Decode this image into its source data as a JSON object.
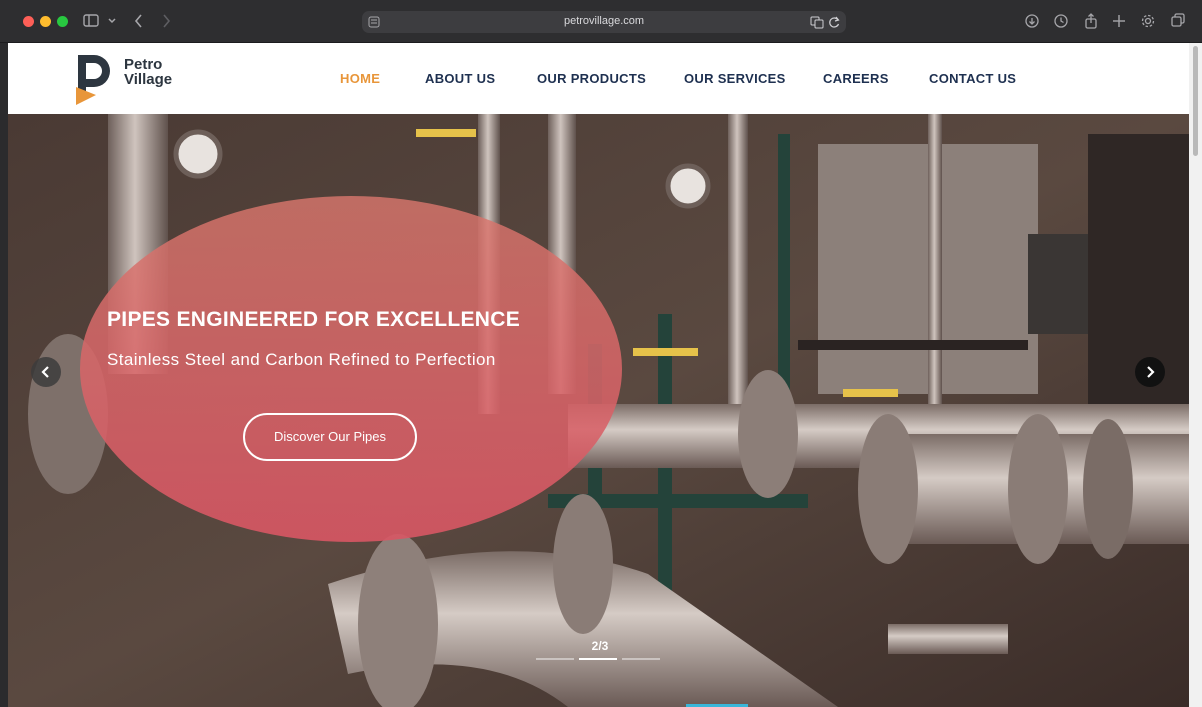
{
  "browser": {
    "url": "petrovillage.com",
    "icons": [
      "sidebar-icon",
      "chevron-down-icon",
      "back-icon",
      "forward-icon",
      "translate-icon",
      "reload-icon",
      "download-icon",
      "history-icon",
      "share-icon",
      "new-tab-icon",
      "settings-icon",
      "tabs-icon"
    ]
  },
  "site": {
    "logo": {
      "line1": "Petro",
      "line2": "Village"
    },
    "nav": [
      "HOME",
      "ABOUT US",
      "OUR PRODUCTS",
      "OUR SERVICES",
      "CAREERS",
      "CONTACT US"
    ],
    "active_nav": "HOME",
    "accent_color": "#e8963a",
    "nav_color": "#1e3050"
  },
  "hero": {
    "title": "PIPES ENGINEERED FOR EXCELLENCE",
    "subtitle": "Stainless Steel and Carbon Refined to Perfection",
    "cta": "Discover Our Pipes",
    "counter": "2/3",
    "current_slide": 2,
    "total_slides": 3,
    "blob_color": "#d86a6e"
  }
}
